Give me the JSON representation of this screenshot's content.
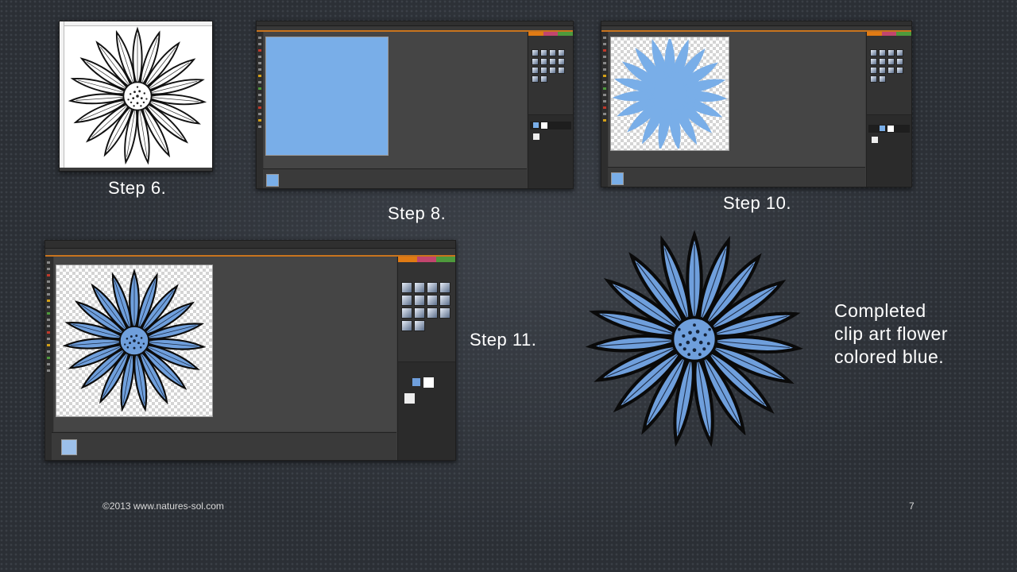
{
  "captions": {
    "step6": "Step 6.",
    "step8": "Step 8.",
    "step10": "Step 10.",
    "step11": "Step 11."
  },
  "completed_text": [
    "Completed",
    "clip art flower",
    "colored blue."
  ],
  "footer": {
    "copyright": "©2013 www.natures-sol.com",
    "page_number": "7"
  },
  "colors": {
    "flower_blue": "#6f9fdc",
    "fill_blue": "#79aee8",
    "accent_orange": "#c8741e",
    "tab_orange": "#e07b14",
    "tab_pink": "#c2456e",
    "tab_green": "#4e9a3c"
  },
  "icons": {
    "flower": "daisy-flower-icon"
  }
}
